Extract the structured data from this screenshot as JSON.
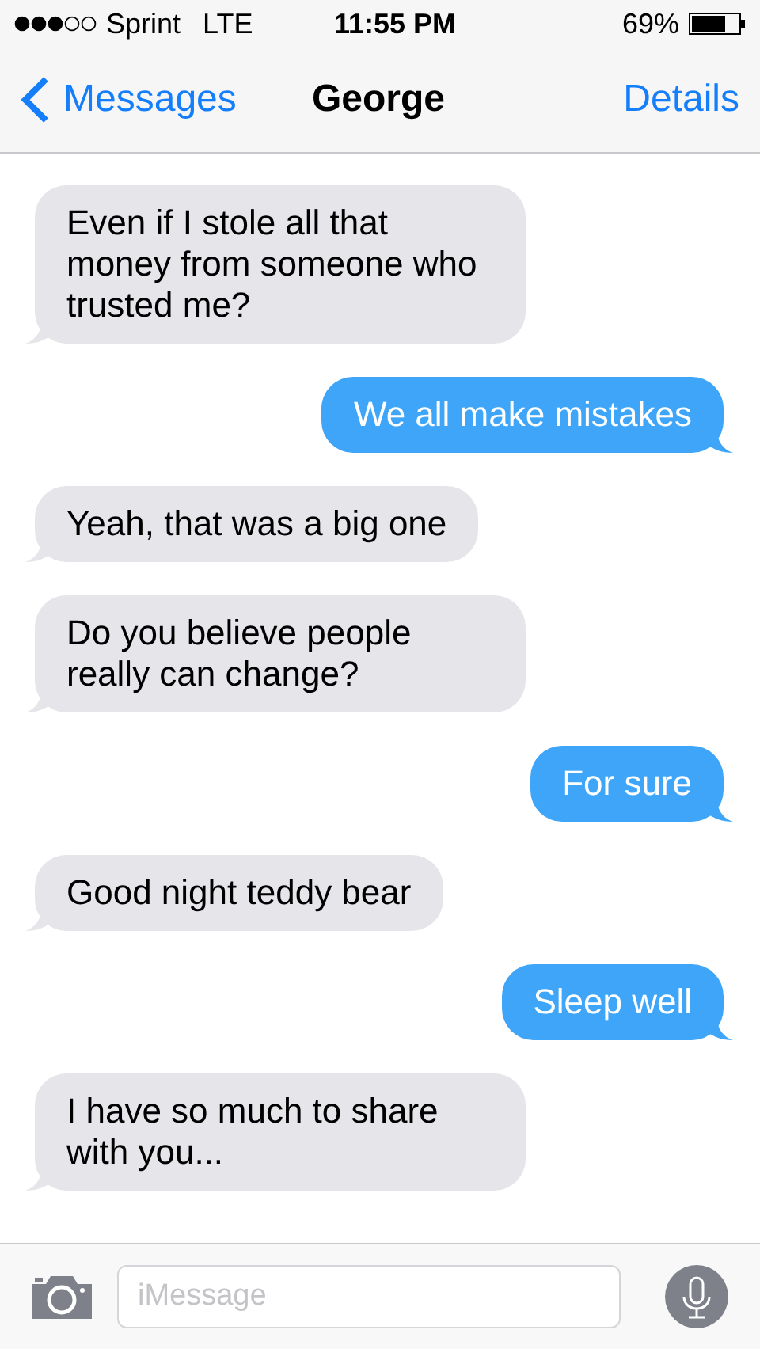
{
  "status_bar": {
    "carrier": "Sprint",
    "network": "LTE",
    "time": "11:55 PM",
    "battery": "69%"
  },
  "nav": {
    "back": "Messages",
    "title": "George",
    "action": "Details"
  },
  "messages": [
    {
      "kind": "received",
      "text": "Even if I stole all that money from someone who trusted me?"
    },
    {
      "kind": "sent",
      "text": "We all make mistakes"
    },
    {
      "kind": "received",
      "text": "Yeah, that was a big one"
    },
    {
      "kind": "received",
      "text": "Do you believe people really can change?"
    },
    {
      "kind": "sent",
      "text": "For sure"
    },
    {
      "kind": "received",
      "text": "Good night teddy bear"
    },
    {
      "kind": "sent",
      "text": "Sleep well"
    },
    {
      "kind": "received",
      "text": "I have so much to share with you..."
    }
  ],
  "composer": {
    "placeholder": "iMessage"
  }
}
